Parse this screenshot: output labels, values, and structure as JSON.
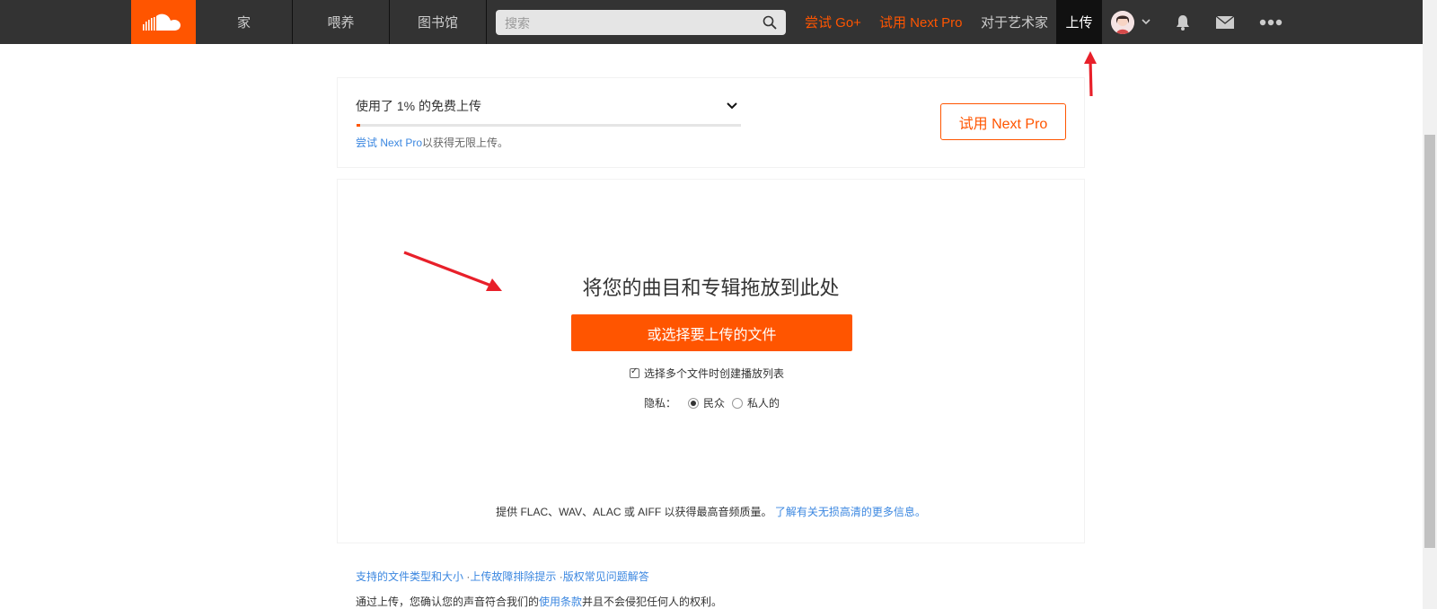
{
  "nav": {
    "home": "家",
    "feed": "喂养",
    "library": "图书馆",
    "search_placeholder": "搜索",
    "try_go": "尝试 Go+",
    "try_next_pro": "试用 Next Pro",
    "for_artists": "对于艺术家",
    "upload": "上传",
    "icons": [
      "soundcloud-logo-icon",
      "search-icon",
      "avatar",
      "chevron-down-icon",
      "bell-icon",
      "mail-icon",
      "more-icon"
    ]
  },
  "quota": {
    "title": "使用了 1% 的免费上传",
    "percent_used": 1,
    "hint_link": "尝试 Next Pro",
    "hint_text": "以获得无限上传。",
    "pro_button": "试用 Next Pro"
  },
  "upload": {
    "drop_title": "将您的曲目和专辑拖放到此处",
    "choose_button": "或选择要上传的文件",
    "playlist_checkbox_label": "选择多个文件时创建播放列表",
    "playlist_checked": true,
    "privacy_label": "隐私：",
    "privacy_public": "民众",
    "privacy_private": "私人的",
    "privacy_selected": "public",
    "quality_text": "提供 FLAC、WAV、ALAC 或 AIFF 以获得最高音频质量。",
    "quality_link": "了解有关无损高清的更多信息。"
  },
  "footer": {
    "link_filetypes": "支持的文件类型和大小",
    "link_troubleshoot": "上传故障排除提示",
    "link_copyright": "版权常见问题解答",
    "sep": "·",
    "terms_prefix": "通过上传，您确认您的声音符合我们的",
    "terms_link": "使用条款",
    "terms_suffix": "并且不会侵犯任何人的权利。"
  },
  "colors": {
    "brand": "#ff5500",
    "topbar": "#333333",
    "link": "#3b87e0",
    "annotation": "#e8202a"
  }
}
